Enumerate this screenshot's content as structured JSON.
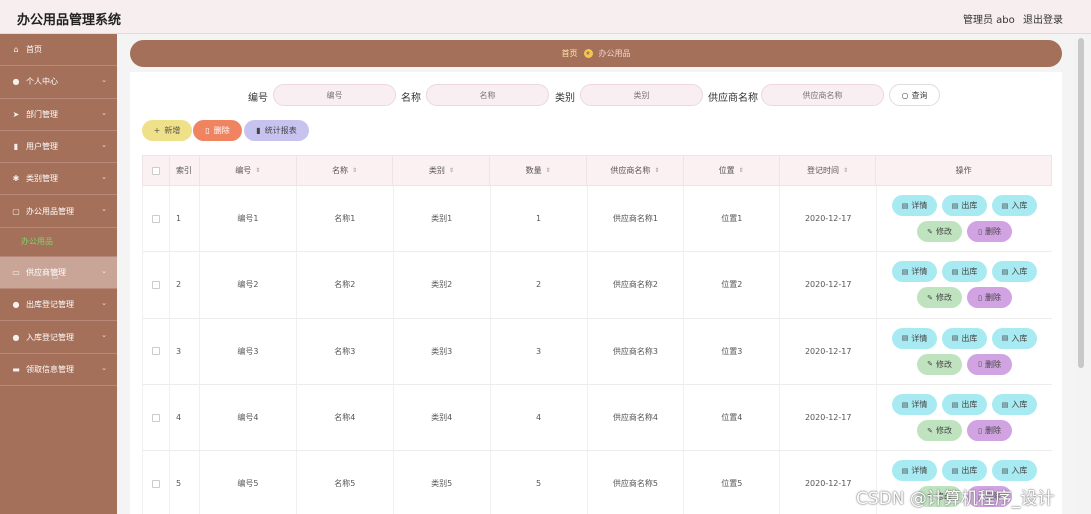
{
  "app": {
    "title": "办公用品管理系统",
    "user": "管理员 abo",
    "logout": "退出登录"
  },
  "sidebar": {
    "items": [
      {
        "label": "首页",
        "icon": "home-icon",
        "glyph": "⌂"
      },
      {
        "label": "个人中心",
        "icon": "user-icon",
        "glyph": "●"
      },
      {
        "label": "部门管理",
        "icon": "send-icon",
        "glyph": "➤"
      },
      {
        "label": "用户管理",
        "icon": "chart-icon",
        "glyph": "▮"
      },
      {
        "label": "类别管理",
        "icon": "gear-icon",
        "glyph": "✱"
      },
      {
        "label": "办公用品管理",
        "icon": "box-icon",
        "glyph": "▢"
      },
      {
        "label": "供应商管理",
        "icon": "folder-icon",
        "glyph": "▭"
      },
      {
        "label": "出库登记管理",
        "icon": "users-icon",
        "glyph": "●"
      },
      {
        "label": "入库登记管理",
        "icon": "person-icon",
        "glyph": "●"
      },
      {
        "label": "领取信息管理",
        "icon": "card-icon",
        "glyph": "▬"
      }
    ],
    "sub_item": "办公用品",
    "arrow": "⌄"
  },
  "breadcrumb": {
    "home": "首页",
    "separator": "★",
    "current": "办公用品"
  },
  "search": {
    "fields": [
      {
        "label": "编号",
        "placeholder": "编号"
      },
      {
        "label": "名称",
        "placeholder": "名称"
      },
      {
        "label": "类别",
        "placeholder": "类别"
      },
      {
        "label": "供应商名称",
        "placeholder": "供应商名称"
      }
    ],
    "button": "查询",
    "button_icon": "○"
  },
  "actions": {
    "add": "新增",
    "add_icon": "+",
    "delete": "删除",
    "delete_icon": "▯",
    "stats": "统计报表",
    "stats_icon": "▮"
  },
  "table": {
    "headers": [
      "索引",
      "编号",
      "名称",
      "类别",
      "数量",
      "供应商名称",
      "位置",
      "登记时间",
      "操作"
    ],
    "sort_icon": "⇕",
    "rows": [
      {
        "index": "1",
        "code": "编号1",
        "name": "名称1",
        "category": "类别1",
        "qty": "1",
        "supplier": "供应商名称1",
        "location": "位置1",
        "date": "2020-12-17"
      },
      {
        "index": "2",
        "code": "编号2",
        "name": "名称2",
        "category": "类别2",
        "qty": "2",
        "supplier": "供应商名称2",
        "location": "位置2",
        "date": "2020-12-17"
      },
      {
        "index": "3",
        "code": "编号3",
        "name": "名称3",
        "category": "类别3",
        "qty": "3",
        "supplier": "供应商名称3",
        "location": "位置3",
        "date": "2020-12-17"
      },
      {
        "index": "4",
        "code": "编号4",
        "name": "名称4",
        "category": "类别4",
        "qty": "4",
        "supplier": "供应商名称4",
        "location": "位置4",
        "date": "2020-12-17"
      },
      {
        "index": "5",
        "code": "编号5",
        "name": "名称5",
        "category": "类别5",
        "qty": "5",
        "supplier": "供应商名称5",
        "location": "位置5",
        "date": "2020-12-17"
      }
    ],
    "ops": {
      "detail": "详情",
      "out": "出库",
      "in": "入库",
      "edit": "修改",
      "remove": "删除",
      "doc_icon": "▤",
      "edit_icon": "✎",
      "trash_icon": "▯"
    }
  },
  "watermark": "CSDN @计算机程序_设计",
  "colors": {
    "sidebar": "#a4705a",
    "topbar": "#f7eef0",
    "active_sub": "#7dd36b",
    "detail_btn": "#a8eaf2",
    "edit_btn": "#bfe3bf",
    "remove_btn": "#d1a3e3"
  }
}
